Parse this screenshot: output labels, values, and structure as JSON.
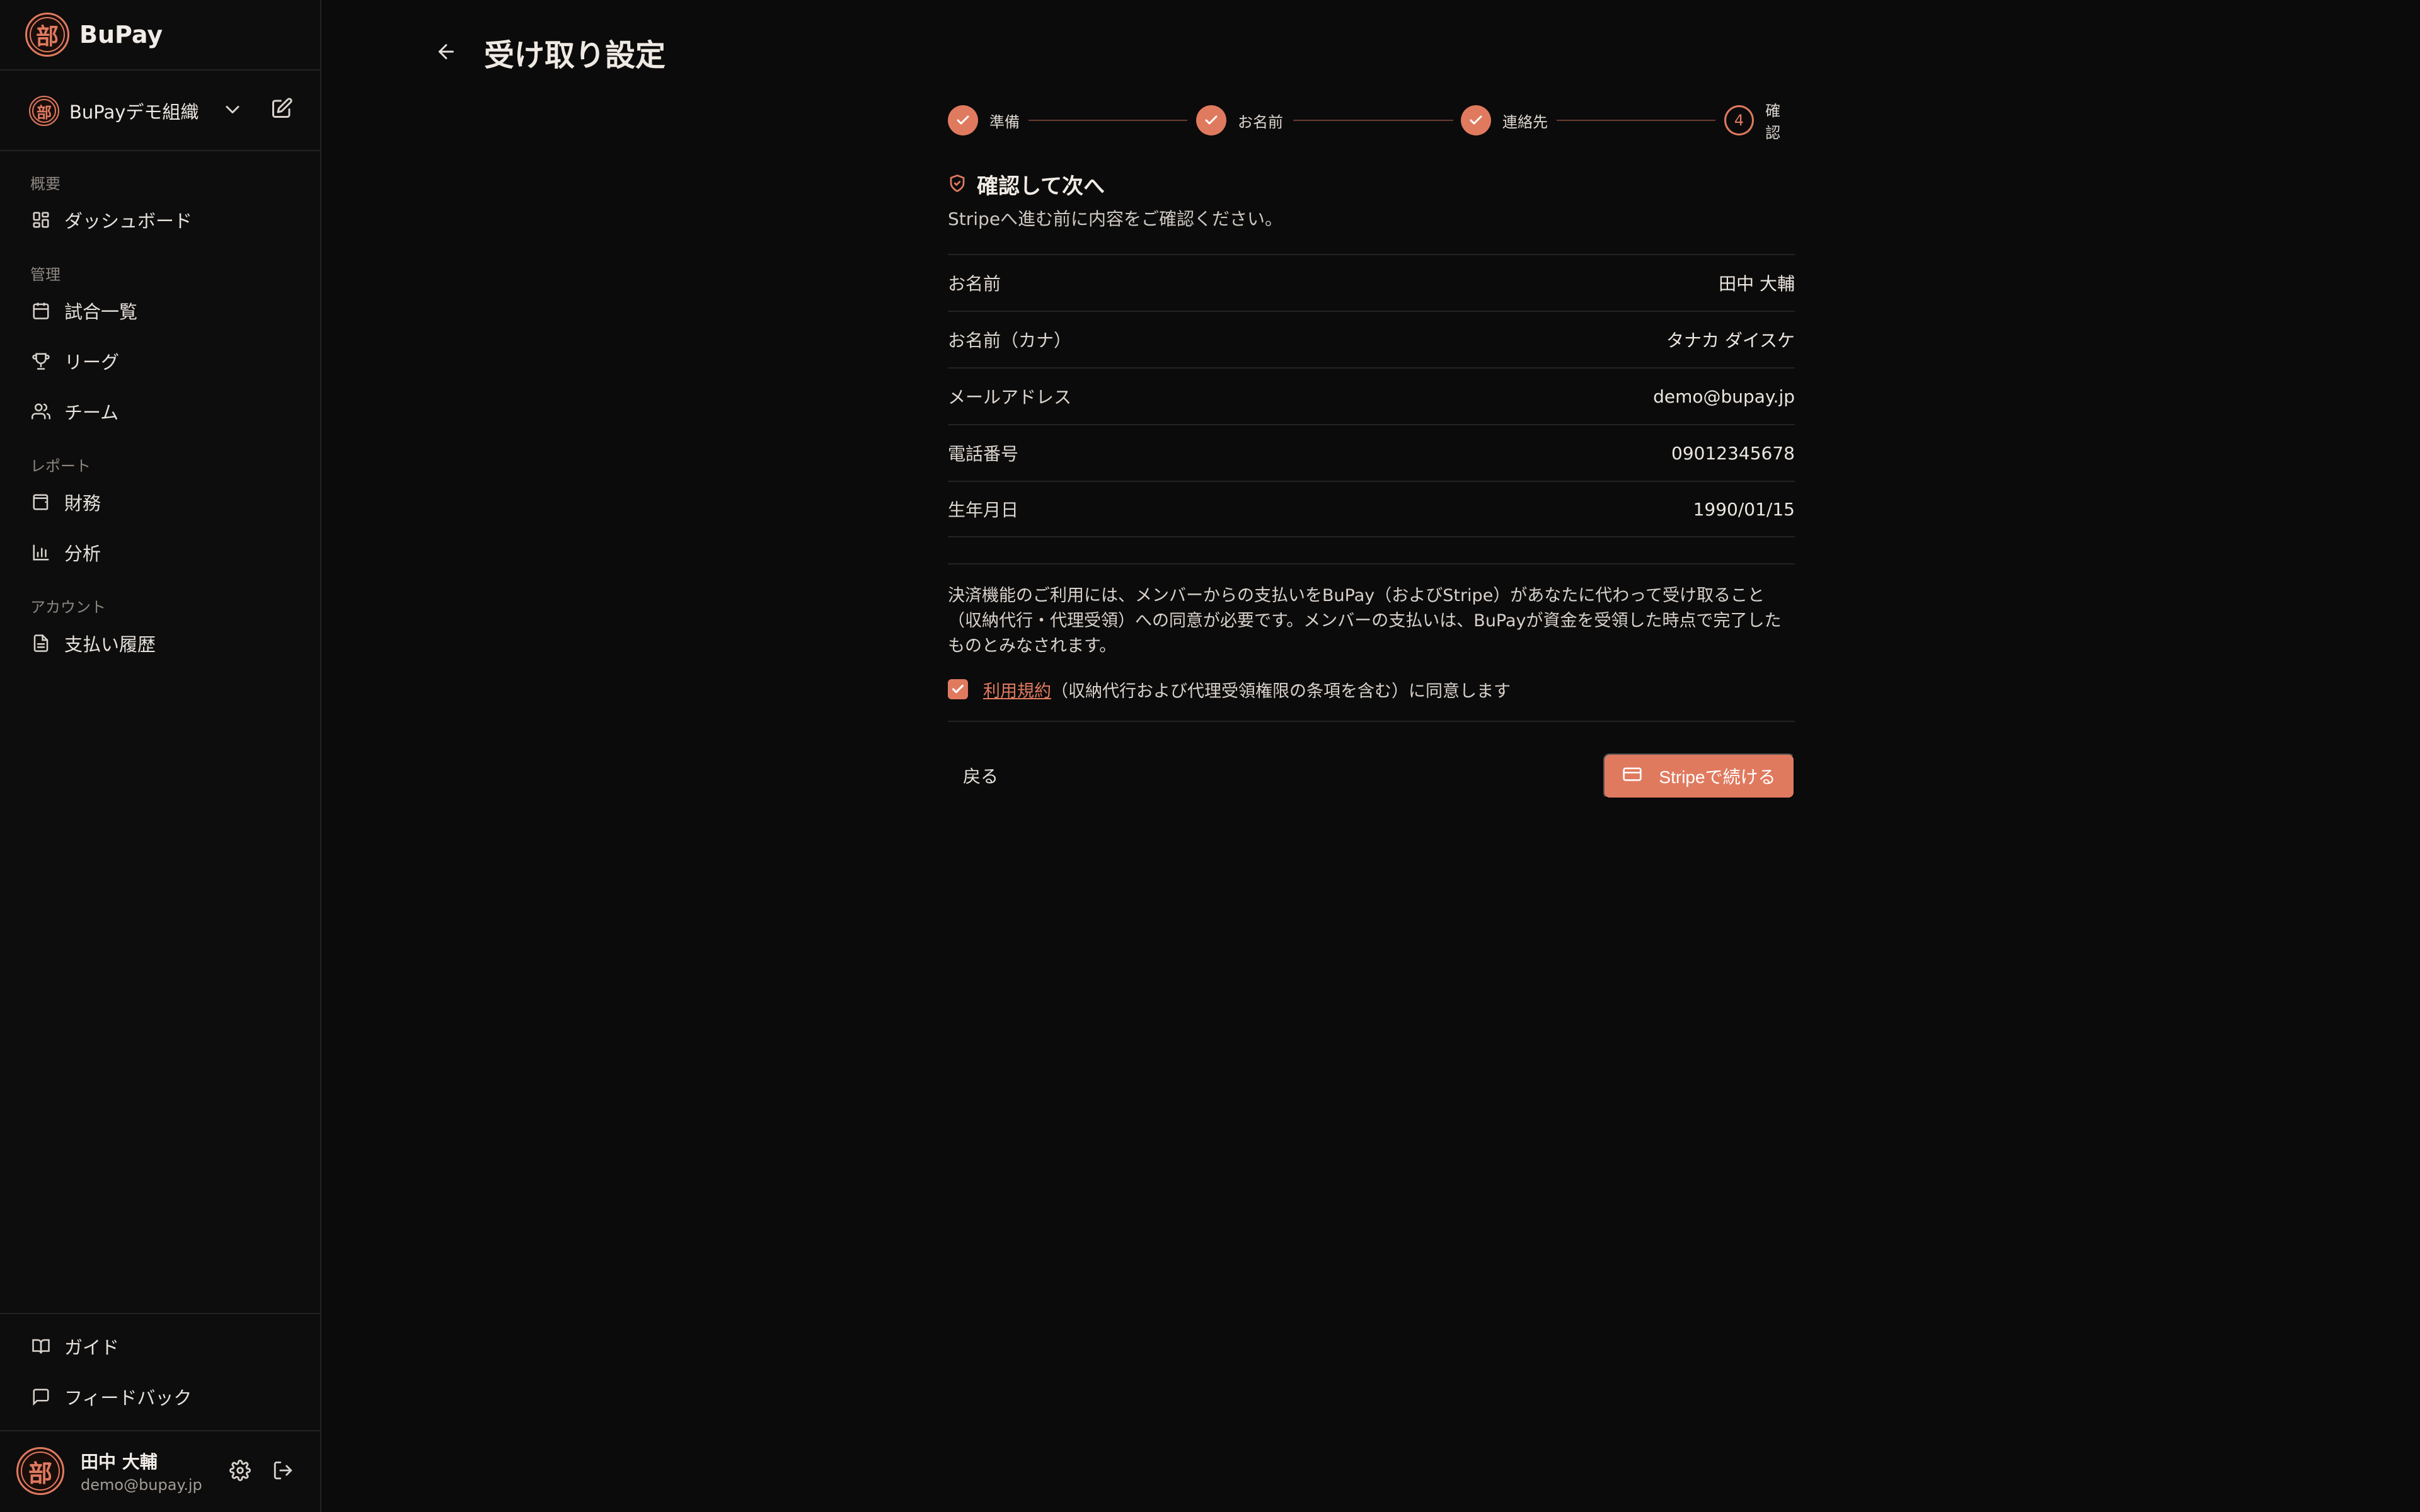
{
  "brand": {
    "logo_char": "部",
    "name": "BuPay"
  },
  "org": {
    "name": "BuPayデモ組織"
  },
  "sidebar": {
    "groups": [
      {
        "label": "概要",
        "items": [
          {
            "label": "ダッシュボード",
            "icon": "grid-icon"
          }
        ]
      },
      {
        "label": "管理",
        "items": [
          {
            "label": "試合一覧",
            "icon": "calendar-icon"
          },
          {
            "label": "リーグ",
            "icon": "trophy-icon"
          },
          {
            "label": "チーム",
            "icon": "users-icon"
          }
        ]
      },
      {
        "label": "レポート",
        "items": [
          {
            "label": "財務",
            "icon": "wallet-icon"
          },
          {
            "label": "分析",
            "icon": "bar-chart-icon"
          }
        ]
      },
      {
        "label": "アカウント",
        "items": [
          {
            "label": "支払い履歴",
            "icon": "receipt-icon"
          }
        ]
      }
    ],
    "footer": [
      {
        "label": "ガイド",
        "icon": "book-icon"
      },
      {
        "label": "フィードバック",
        "icon": "message-icon"
      }
    ]
  },
  "user": {
    "name": "田中 大輔",
    "email": "demo@bupay.jp"
  },
  "page": {
    "title": "受け取り設定"
  },
  "stepper": [
    {
      "label": "準備",
      "state": "done"
    },
    {
      "label": "お名前",
      "state": "done"
    },
    {
      "label": "連絡先",
      "state": "done"
    },
    {
      "label": "確認",
      "number": "4",
      "state": "current"
    }
  ],
  "section": {
    "title": "確認して次へ",
    "subtitle": "Stripeへ進む前に内容をご確認ください。"
  },
  "summary": [
    {
      "label": "お名前",
      "value": "田中 大輔"
    },
    {
      "label": "お名前（カナ）",
      "value": "タナカ ダイスケ"
    },
    {
      "label": "メールアドレス",
      "value": "demo@bupay.jp"
    },
    {
      "label": "電話番号",
      "value": "09012345678"
    },
    {
      "label": "生年月日",
      "value": "1990/01/15"
    }
  ],
  "notice": "決済機能のご利用には、メンバーからの支払いをBuPay（およびStripe）があなたに代わって受け取ること（収納代行・代理受領）への同意が必要です。メンバーの支払いは、BuPayが資金を受領した時点で完了したものとみなされます。",
  "agree": {
    "checked": true,
    "link": "利用規約",
    "rest": "（収納代行および代理受領権限の条項を含む）に同意します"
  },
  "actions": {
    "back": "戻る",
    "continue": "Stripeで続ける"
  },
  "colors": {
    "accent": "#e07a5f",
    "background": "#0b0b0b",
    "sidebar": "#0d0d0d"
  }
}
